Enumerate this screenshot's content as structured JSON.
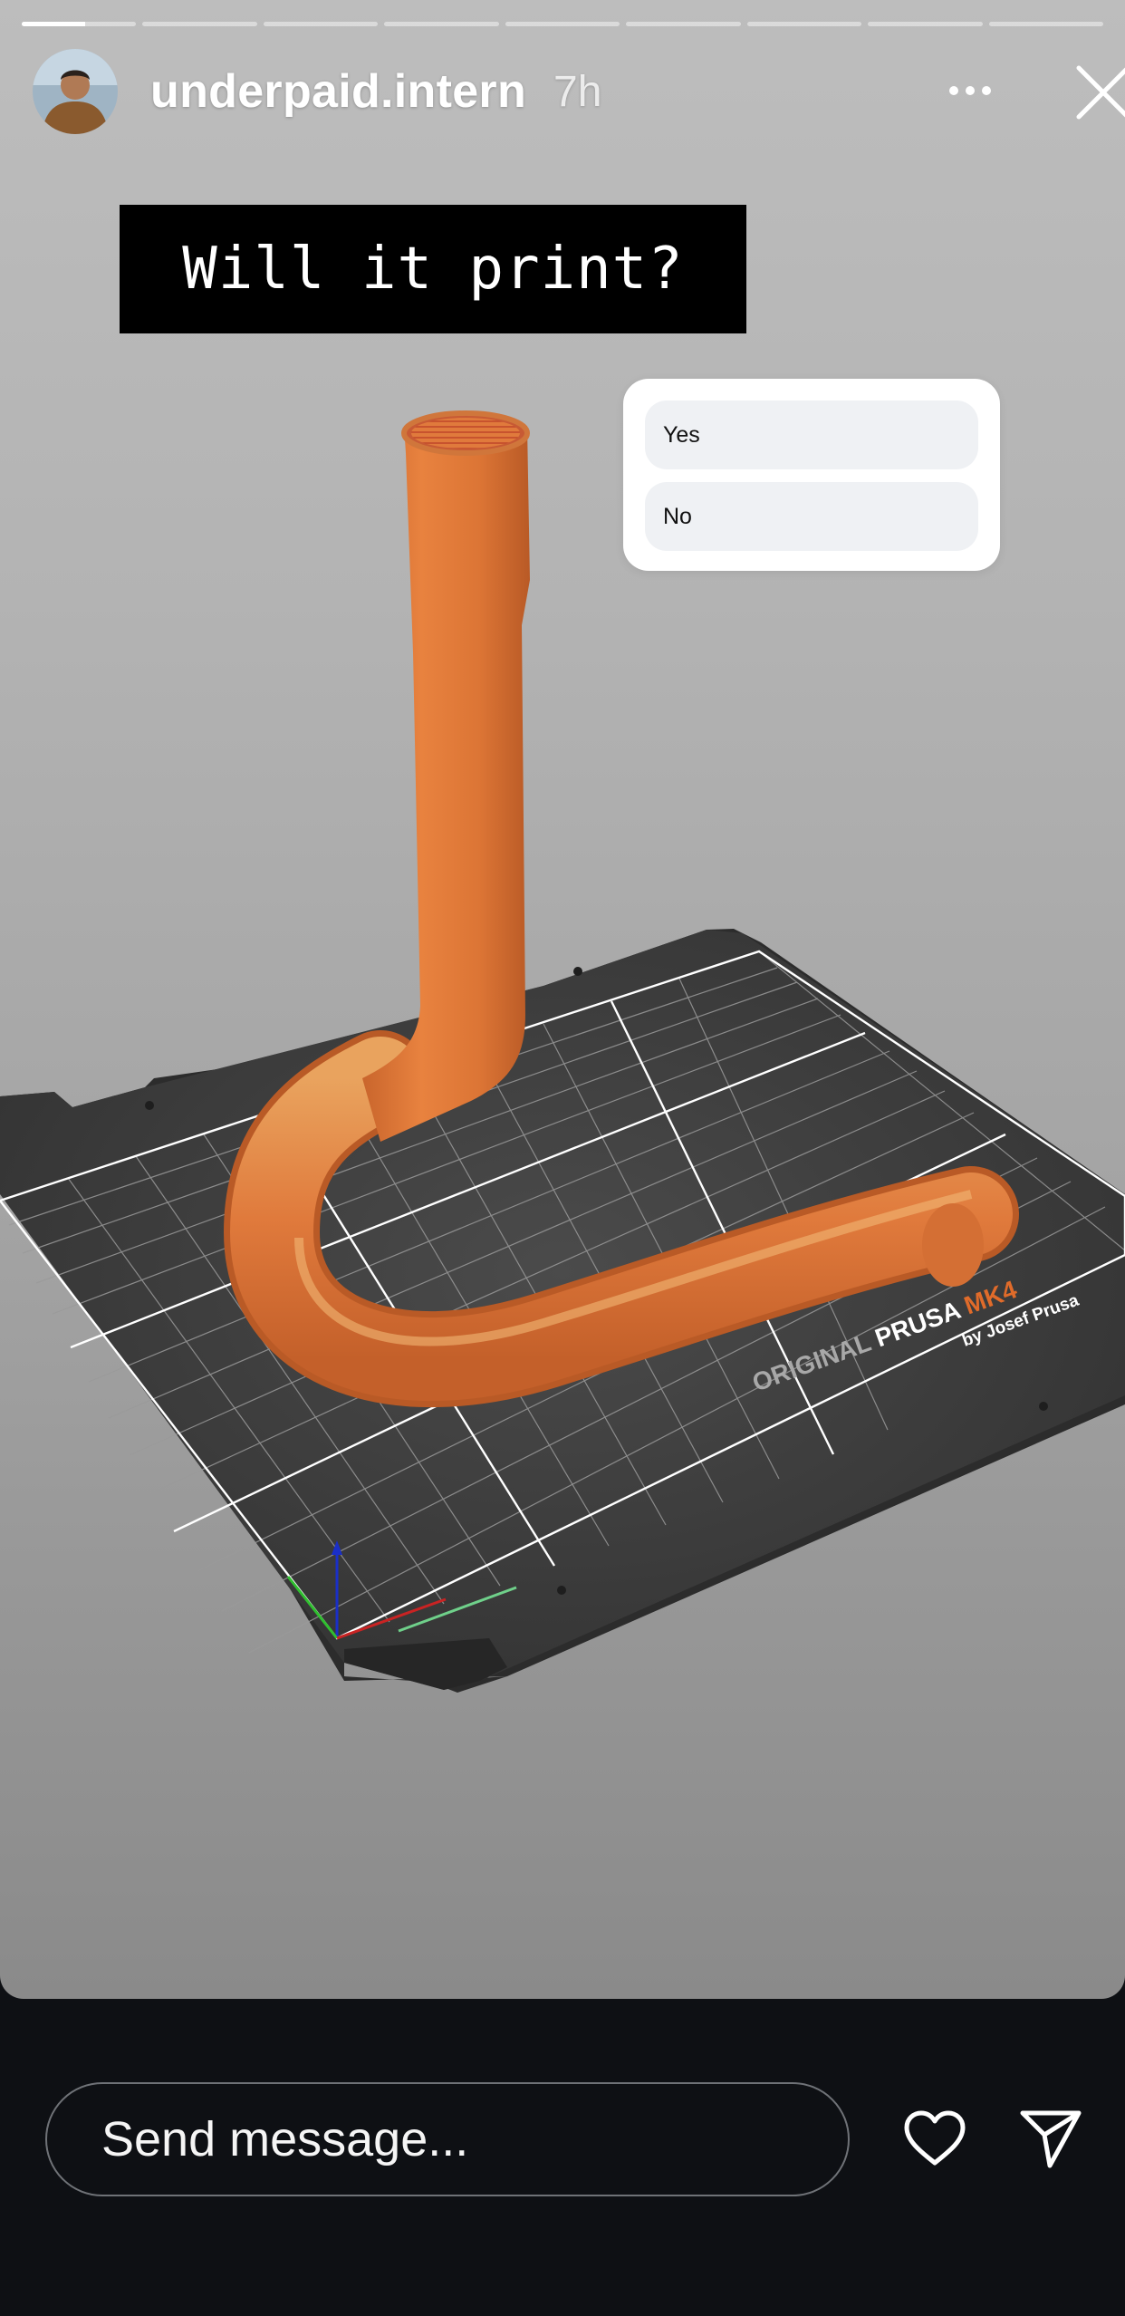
{
  "story": {
    "progress": {
      "segments": 9,
      "current_segment": 1,
      "current_fill": 0.55
    },
    "user": {
      "username": "underpaid.intern",
      "time_ago": "7h"
    },
    "caption": "Will it print?",
    "poll": {
      "options": [
        {
          "label": "Yes"
        },
        {
          "label": "No"
        }
      ]
    },
    "printer_bed": {
      "brand_prefix": "ORIGINAL",
      "brand": "PRUSA",
      "model": "MK4",
      "byline": "by Josef Prusa"
    },
    "icons": {
      "more": "more-horizontal-icon",
      "close": "close-icon"
    }
  },
  "footer": {
    "message_placeholder": "Send message...",
    "icons": {
      "like": "heart-icon",
      "send": "send-icon"
    }
  },
  "colors": {
    "filament": "#e07a3c",
    "bed": "#3c3c3c",
    "caption_bg": "#000000",
    "accent": "#e06b2a"
  }
}
